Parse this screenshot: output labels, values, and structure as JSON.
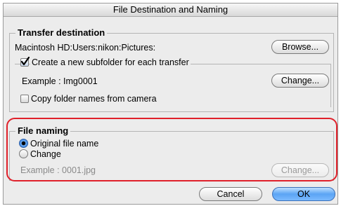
{
  "window": {
    "title": "File Destination and Naming"
  },
  "transfer": {
    "group_title": "Transfer  destination",
    "path": "Macintosh HD:Users:nikon:Pictures:",
    "browse_label": "Browse...",
    "subfolder_label": "Create a new subfolder for each transfer",
    "subfolder_checked": true,
    "example": "Example : Img0001",
    "change_label": "Change...",
    "copy_folder_label": "Copy folder names from camera",
    "copy_folder_checked": false
  },
  "naming": {
    "group_title": "File naming",
    "original_label": "Original file name",
    "change_option_label": "Change",
    "selected": "Original file name",
    "example": "Example : 0001.jpg",
    "change_label": "Change..."
  },
  "dialog": {
    "cancel_label": "Cancel",
    "ok_label": "OK"
  },
  "colors": {
    "highlight": "#e0202a",
    "default_button": "#5aa4f4"
  }
}
